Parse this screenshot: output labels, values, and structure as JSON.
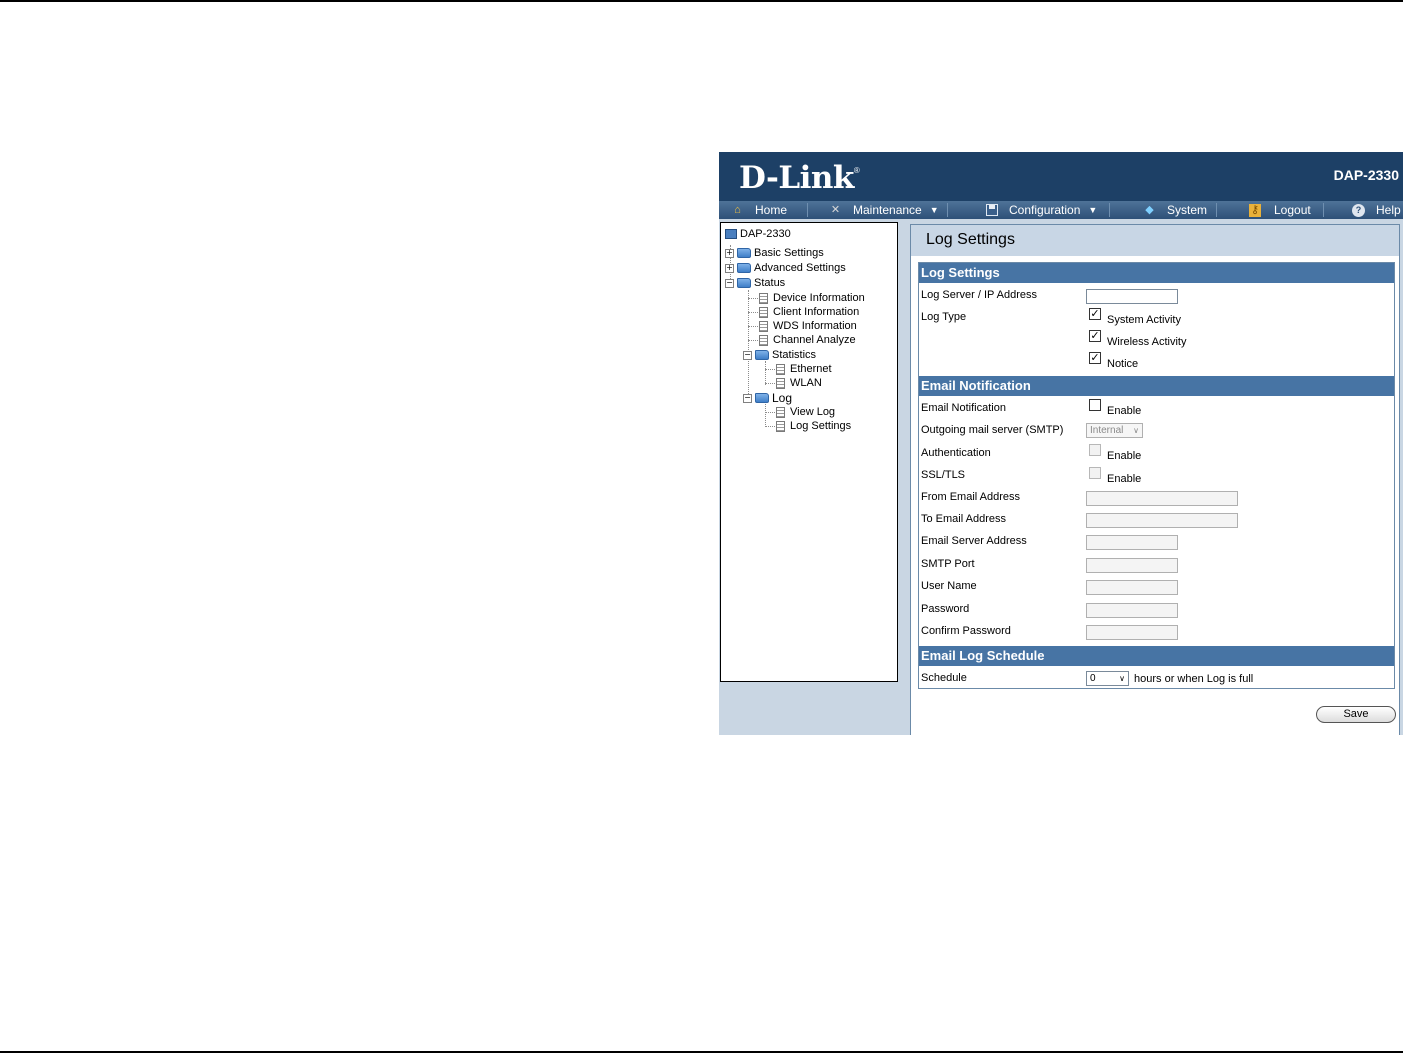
{
  "header": {
    "logo": "D-Link",
    "logo_mark": "®",
    "model": "DAP-2330"
  },
  "nav": [
    {
      "label": "Home",
      "icon": "home-icon"
    },
    {
      "label": "Maintenance",
      "icon": "tools-icon",
      "dropdown": true
    },
    {
      "label": "Configuration",
      "icon": "save-disk-icon",
      "dropdown": true
    },
    {
      "label": "System",
      "icon": "network-icon"
    },
    {
      "label": "Logout",
      "icon": "key-icon"
    },
    {
      "label": "Help",
      "icon": "help-icon"
    }
  ],
  "tree": {
    "root": "DAP-2330",
    "basic": "Basic Settings",
    "advanced": "Advanced Settings",
    "status": "Status",
    "device_info": "Device Information",
    "client_info": "Client Information",
    "wds_info": "WDS Information",
    "channel": "Channel Analyze",
    "statistics": "Statistics",
    "ethernet": "Ethernet",
    "wlan": "WLAN",
    "log": "Log",
    "view_log": "View Log",
    "log_settings": "Log Settings"
  },
  "page": {
    "title": "Log Settings"
  },
  "log_settings": {
    "header": "Log Settings",
    "server_label": "Log Server / IP Address",
    "server_value": "",
    "type_label": "Log Type",
    "system_activity": "System Activity",
    "wireless_activity": "Wireless Activity",
    "notice": "Notice",
    "system_checked": true,
    "wireless_checked": true,
    "notice_checked": true
  },
  "email": {
    "header": "Email Notification",
    "notification_label": "Email Notification",
    "notification_enable": "Enable",
    "smtp_label": "Outgoing mail server (SMTP)",
    "smtp_value": "Internal",
    "auth_label": "Authentication",
    "auth_enable": "Enable",
    "ssl_label": "SSL/TLS",
    "ssl_enable": "Enable",
    "from_label": "From Email Address",
    "to_label": "To Email Address",
    "server_label": "Email Server Address",
    "port_label": "SMTP Port",
    "user_label": "User Name",
    "password_label": "Password",
    "confirm_label": "Confirm Password"
  },
  "schedule": {
    "header": "Email Log Schedule",
    "label": "Schedule",
    "value": "0",
    "suffix": "hours or when Log is full"
  },
  "actions": {
    "save": "Save"
  }
}
